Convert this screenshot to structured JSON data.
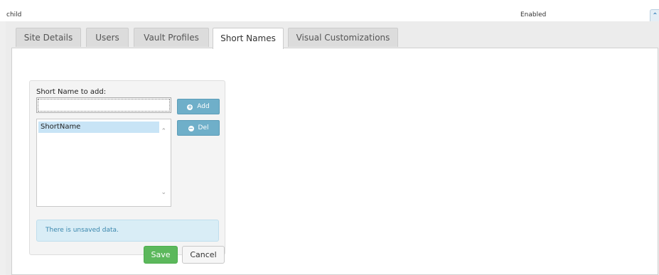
{
  "header": {
    "name": "child",
    "status": "Enabled",
    "collapse_icon": "chevron-up-icon"
  },
  "tabs": [
    {
      "label": "Site Details",
      "active": false
    },
    {
      "label": "Users",
      "active": false
    },
    {
      "label": "Vault Profiles",
      "active": false
    },
    {
      "label": "Short Names",
      "active": true
    },
    {
      "label": "Visual Customizations",
      "active": false
    }
  ],
  "short_names": {
    "input_label": "Short Name to add:",
    "input_value": "",
    "list_items": [
      "ShortName"
    ],
    "add_label": "Add",
    "add_icon": "plus-circle-icon",
    "del_label": "Del",
    "del_icon": "minus-circle-icon",
    "alert_text": "There is unsaved data."
  },
  "footer": {
    "save_label": "Save",
    "cancel_label": "Cancel"
  },
  "colors": {
    "primary_button": "#6fafc9",
    "save_button": "#5cb85c",
    "alert_background": "#d9edf6",
    "alert_text": "#3a87ad",
    "selection": "#c8e4f6"
  }
}
